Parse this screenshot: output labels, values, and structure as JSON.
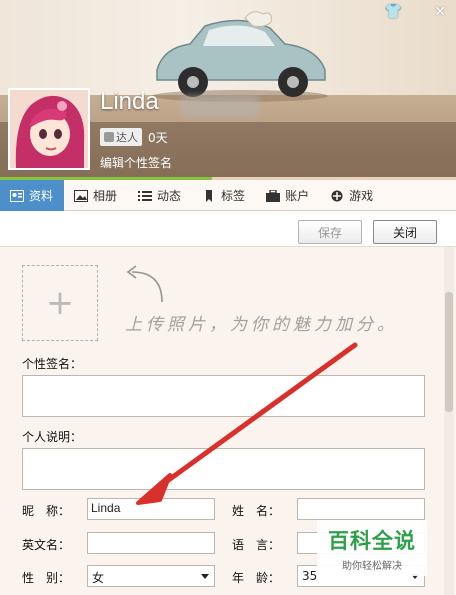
{
  "profile": {
    "username": "Linda",
    "level_label": "达人",
    "days": "0天",
    "edit_signature": "编辑个性签名"
  },
  "tabs": [
    {
      "label": "资料",
      "icon": "profile-card-icon",
      "active": true
    },
    {
      "label": "相册",
      "icon": "photo-album-icon",
      "active": false
    },
    {
      "label": "动态",
      "icon": "list-icon",
      "active": false
    },
    {
      "label": "标签",
      "icon": "bookmark-icon",
      "active": false
    },
    {
      "label": "账户",
      "icon": "briefcase-icon",
      "active": false
    },
    {
      "label": "游戏",
      "icon": "game-icon",
      "active": false
    }
  ],
  "toolbar": {
    "save_label": "保存",
    "close_label": "关闭"
  },
  "photo": {
    "hint": "上传照片，为你的魅力加分。"
  },
  "form": {
    "signature_label": "个性签名：",
    "intro_label": "个人说明：",
    "nickname_label": "昵　称：",
    "nickname_value": "Linda",
    "realname_label": "姓　名：",
    "realname_value": "",
    "english_label": "英文名：",
    "english_value": "",
    "language_label": "语　言：",
    "language_value": "",
    "gender_label": "性　别：",
    "gender_value": "女",
    "age_label": "年　龄：",
    "age_value": "35"
  },
  "watermark": {
    "title": "百科全说",
    "subtitle": "助你轻松解决"
  },
  "colors": {
    "tab_active": "#4d8fcb",
    "accent_green": "#86c440",
    "arrow_red": "#d9302c"
  }
}
